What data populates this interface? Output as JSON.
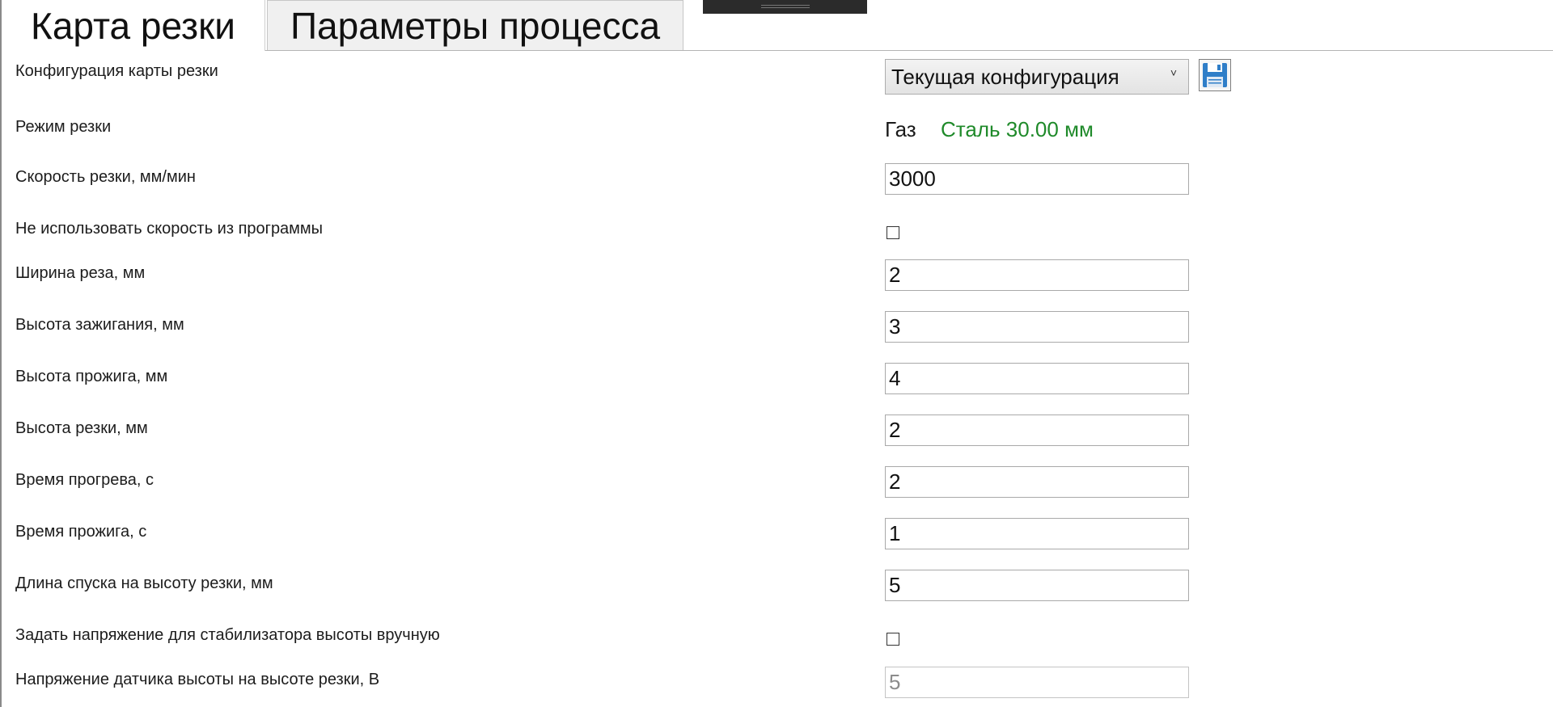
{
  "tabs": {
    "cutting_map": "Карта резки",
    "process_params": "Параметры процесса"
  },
  "colors": {
    "material_text": "#1f8a2a",
    "save_icon": "#2f7ec8"
  },
  "config": {
    "label": "Конфигурация карты резки",
    "selected": "Текущая конфигурация",
    "chevron": "˅",
    "save_icon": "floppy-disk-icon"
  },
  "mode": {
    "label": "Режим резки",
    "gas": "Газ",
    "material": "Сталь 30.00 мм"
  },
  "fields": {
    "cut_speed": {
      "label": "Скорость резки, мм/мин",
      "value": "3000"
    },
    "ignore_program_speed": {
      "label": "Не использовать скорость из программы",
      "checked": false
    },
    "kerf_width": {
      "label": "Ширина реза, мм",
      "value": "2"
    },
    "ignition_height": {
      "label": "Высота зажигания, мм",
      "value": "3"
    },
    "pierce_height": {
      "label": "Высота прожига, мм",
      "value": "4"
    },
    "cut_height": {
      "label": "Высота резки, мм",
      "value": "2"
    },
    "preheat_time": {
      "label": "Время прогрева, с",
      "value": "2"
    },
    "pierce_time": {
      "label": "Время прожига, с",
      "value": "1"
    },
    "descent_length": {
      "label": "Длина спуска на высоту резки, мм",
      "value": "5"
    },
    "manual_voltage": {
      "label": "Задать напряжение для стабилизатора высоты вручную",
      "checked": false
    },
    "sensor_voltage": {
      "label": "Напряжение датчика высоты на высоте резки, В",
      "value": "5"
    }
  }
}
